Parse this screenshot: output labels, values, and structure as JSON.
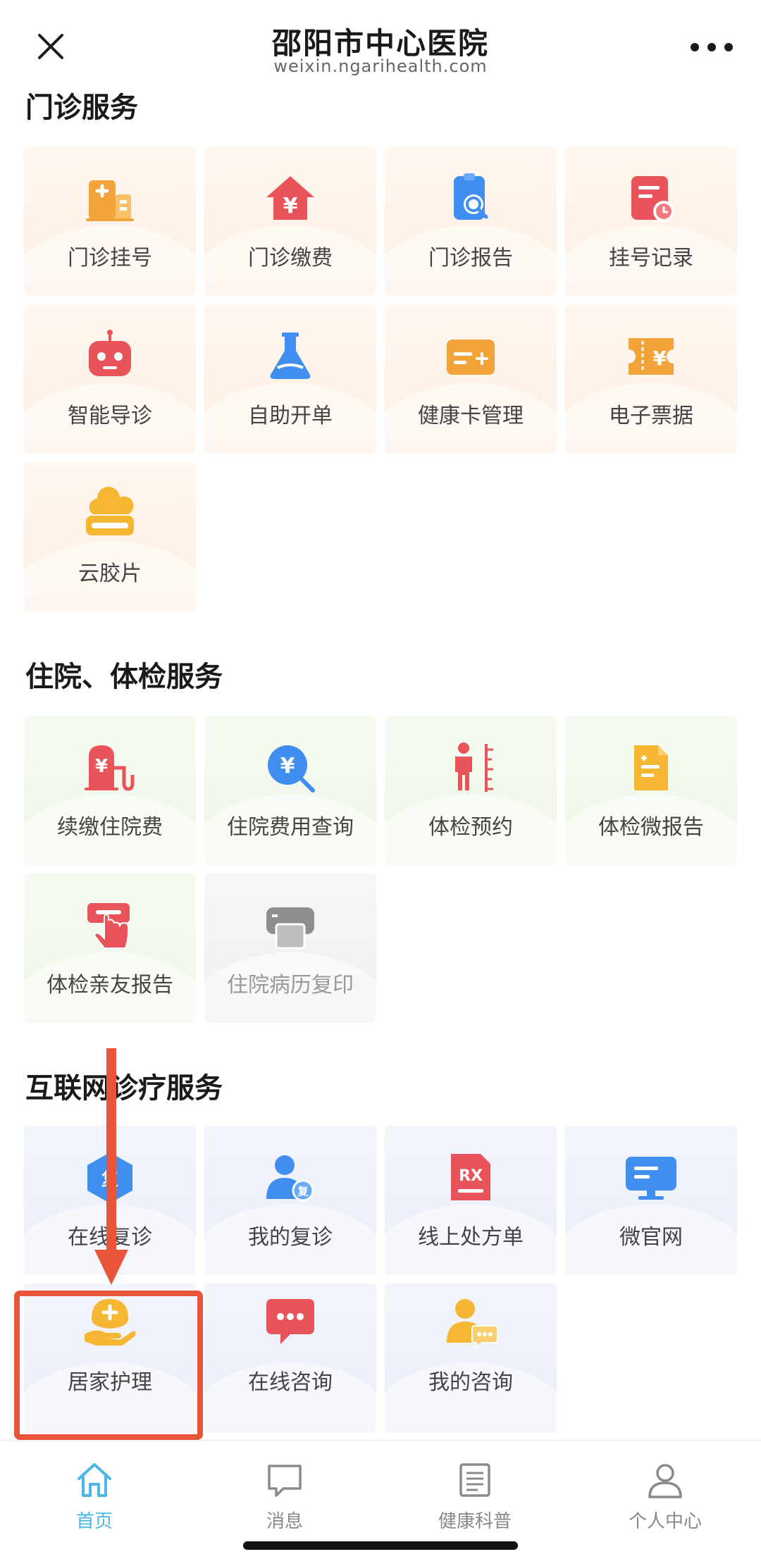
{
  "header": {
    "title": "邵阳市中心医院",
    "subtitle": "weixin.ngarihealth.com"
  },
  "sections": [
    {
      "title": "门诊服务",
      "items": [
        {
          "label": "门诊挂号",
          "icon": "hospital-building-icon"
        },
        {
          "label": "门诊缴费",
          "icon": "yuan-house-icon"
        },
        {
          "label": "门诊报告",
          "icon": "report-search-icon"
        },
        {
          "label": "挂号记录",
          "icon": "record-clock-icon"
        },
        {
          "label": "智能导诊",
          "icon": "robot-icon"
        },
        {
          "label": "自助开单",
          "icon": "flask-icon"
        },
        {
          "label": "健康卡管理",
          "icon": "health-card-icon"
        },
        {
          "label": "电子票据",
          "icon": "ticket-yuan-icon"
        },
        {
          "label": "云胶片",
          "icon": "cloud-film-icon"
        }
      ]
    },
    {
      "title": "住院、体检服务",
      "items": [
        {
          "label": "续缴住院费",
          "icon": "yuan-pump-icon"
        },
        {
          "label": "住院费用查询",
          "icon": "yuan-search-icon"
        },
        {
          "label": "体检预约",
          "icon": "person-height-icon"
        },
        {
          "label": "体检微报告",
          "icon": "mini-report-icon"
        },
        {
          "label": "体检亲友报告",
          "icon": "hand-tap-icon"
        },
        {
          "label": "住院病历复印",
          "icon": "printer-icon"
        }
      ]
    },
    {
      "title": "互联网诊疗服务",
      "items": [
        {
          "label": "在线复诊",
          "icon": "hexagon-revisit-icon"
        },
        {
          "label": "我的复诊",
          "icon": "user-revisit-icon"
        },
        {
          "label": "线上处方单",
          "icon": "prescription-rx-icon"
        },
        {
          "label": "微官网",
          "icon": "monitor-icon"
        },
        {
          "label": "居家护理",
          "icon": "hand-care-icon"
        },
        {
          "label": "在线咨询",
          "icon": "chat-bubble-icon"
        },
        {
          "label": "我的咨询",
          "icon": "user-chat-icon"
        }
      ]
    }
  ],
  "tabbar": {
    "items": [
      {
        "label": "首页",
        "icon": "home-icon",
        "active": true
      },
      {
        "label": "消息",
        "icon": "message-icon",
        "active": false
      },
      {
        "label": "健康科普",
        "icon": "article-icon",
        "active": false
      },
      {
        "label": "个人中心",
        "icon": "person-icon",
        "active": false
      }
    ]
  },
  "colors": {
    "accent": "#4ab7e8",
    "annotation": "#e8553b",
    "icon_orange": "#f2a33a",
    "icon_red": "#e8545a",
    "icon_blue": "#3f8ef0",
    "icon_yellow": "#f5b731"
  }
}
